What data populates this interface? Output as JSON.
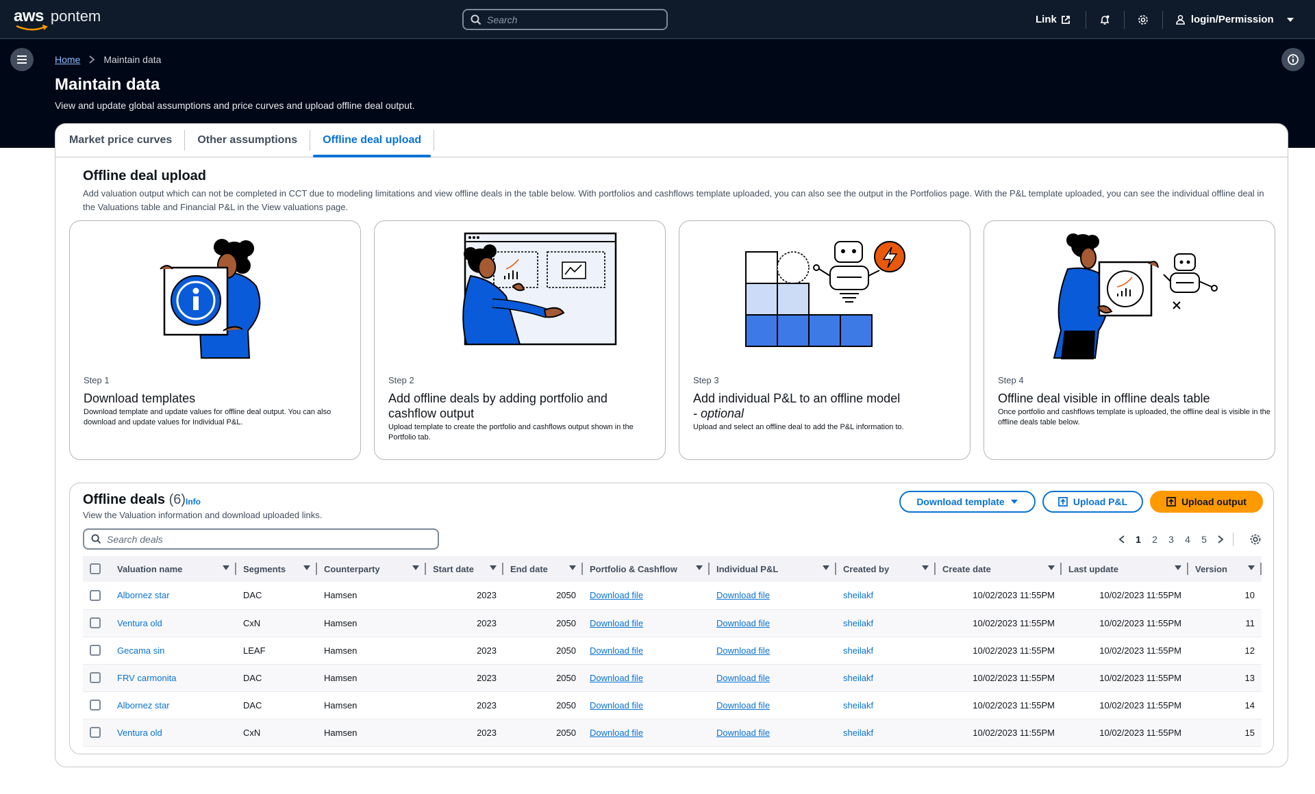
{
  "nav": {
    "brand": "aws",
    "app_name": "pontem",
    "search_placeholder": "Search",
    "link_label": "Link",
    "user_label": "login/Permission"
  },
  "breadcrumb": {
    "home": "Home",
    "current": "Maintain data"
  },
  "page": {
    "title": "Maintain data",
    "description": "View and update global assumptions and price curves and upload offline deal output."
  },
  "tabs": [
    {
      "label": "Market price curves"
    },
    {
      "label": "Other assumptions"
    },
    {
      "label": "Offline deal upload"
    }
  ],
  "section": {
    "title": "Offline deal upload",
    "description": "Add valuation output which can not be completed in CCT due to modeling limitations and view offline deals in the table below. With portfolios and cashflows template uploaded, you can also see the output in the Portfolios page. With the P&L template uploaded, you can see the individual offline deal in the Valuations table and Financial P&L in the View valuations page."
  },
  "steps": [
    {
      "step": "Step 1",
      "title": "Download templates",
      "title_suffix": "",
      "description": "Download template and update values for offline deal output. You can also download and update values for Individual P&L."
    },
    {
      "step": "Step 2",
      "title": "Add offline deals by adding portfolio and cashflow output",
      "title_suffix": "",
      "description": "Upload template to create the portfolio and cashflows output shown in the Portfolio tab."
    },
    {
      "step": "Step 3",
      "title": "Add individual P&L to an offline model",
      "title_suffix": "- optional",
      "description": "Upload and select an offline deal to add the P&L information to."
    },
    {
      "step": "Step 4",
      "title": "Offline deal visible in offline deals table",
      "title_suffix": "",
      "description": "Once portfolio and cashflows template is uploaded, the offline deal is visible in the offline deals table below."
    }
  ],
  "deals": {
    "title": "Offline deals",
    "count": "(6)",
    "info": "Info",
    "description": "View the Valuation information and download uploaded links.",
    "search_placeholder": "Search deals",
    "buttons": {
      "download_template": "Download template",
      "upload_pl": "Upload P&L",
      "upload_output": "Upload output"
    },
    "pages": [
      "1",
      "2",
      "3",
      "4",
      "5"
    ],
    "current_page": "1",
    "columns": [
      "Valuation name",
      "Segments",
      "Counterparty",
      "Start date",
      "End date",
      "Portfolio & Cashflow",
      "Individual P&L",
      "Created by",
      "Create date",
      "Last update",
      "Version"
    ],
    "rows": [
      {
        "name": "Albornez star",
        "segment": "DAC",
        "counterparty": "Hamsen",
        "start": "2023",
        "end": "2050",
        "portfolio": "Download file",
        "pl": "Download file",
        "created_by": "sheilakf",
        "create_date": "10/02/2023 11:55PM",
        "last_update": "10/02/2023 11:55PM",
        "version": "10"
      },
      {
        "name": "Ventura old",
        "segment": "CxN",
        "counterparty": "Hamsen",
        "start": "2023",
        "end": "2050",
        "portfolio": "Download file",
        "pl": "Download file",
        "created_by": "sheilakf",
        "create_date": "10/02/2023 11:55PM",
        "last_update": "10/02/2023 11:55PM",
        "version": "11"
      },
      {
        "name": "Gecama sin",
        "segment": "LEAF",
        "counterparty": "Hamsen",
        "start": "2023",
        "end": "2050",
        "portfolio": "Download file",
        "pl": "Download file",
        "created_by": "sheilakf",
        "create_date": "10/02/2023 11:55PM",
        "last_update": "10/02/2023 11:55PM",
        "version": "12"
      },
      {
        "name": "FRV carmonita",
        "segment": "DAC",
        "counterparty": "Hamsen",
        "start": "2023",
        "end": "2050",
        "portfolio": "Download file",
        "pl": "Download file",
        "created_by": "sheilakf",
        "create_date": "10/02/2023 11:55PM",
        "last_update": "10/02/2023 11:55PM",
        "version": "13"
      },
      {
        "name": "Albornez star",
        "segment": "DAC",
        "counterparty": "Hamsen",
        "start": "2023",
        "end": "2050",
        "portfolio": "Download file",
        "pl": "Download file",
        "created_by": "sheilakf",
        "create_date": "10/02/2023 11:55PM",
        "last_update": "10/02/2023 11:55PM",
        "version": "14"
      },
      {
        "name": "Ventura old",
        "segment": "CxN",
        "counterparty": "Hamsen",
        "start": "2023",
        "end": "2050",
        "portfolio": "Download file",
        "pl": "Download file",
        "created_by": "sheilakf",
        "create_date": "10/02/2023 11:55PM",
        "last_update": "10/02/2023 11:55PM",
        "version": "15"
      }
    ]
  },
  "colors": {
    "accent": "#0972d3",
    "primary_button": "#ff9900",
    "nav_bg": "#0f1b2a",
    "header_bg": "#000716",
    "illustration_blue": "#0a5bd9"
  },
  "icons": [
    "search-icon",
    "external-link-icon",
    "bell-icon",
    "gear-icon",
    "user-icon",
    "caret-down-icon",
    "hamburger-icon",
    "info-icon",
    "chevron-right-icon",
    "chevron-left-icon",
    "upload-icon",
    "settings-icon"
  ]
}
